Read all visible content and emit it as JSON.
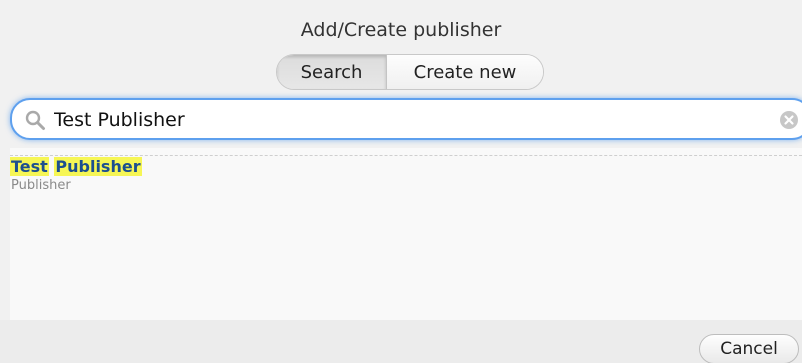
{
  "dialog": {
    "title": "Add/Create publisher"
  },
  "mode_toggle": {
    "search_label": "Search",
    "create_label": "Create new",
    "selected": "Search"
  },
  "search": {
    "value": "Test Publisher",
    "placeholder": ""
  },
  "results": [
    {
      "title_parts": [
        "Test",
        "Publisher"
      ],
      "subtitle": "Publisher"
    }
  ],
  "footer": {
    "cancel_label": "Cancel"
  },
  "colors": {
    "focus_ring": "#5ea0ee",
    "highlight": "#f6f655",
    "result_title": "#1c4f8f"
  },
  "icons": {
    "search": "search-icon",
    "clear": "clear-icon"
  }
}
